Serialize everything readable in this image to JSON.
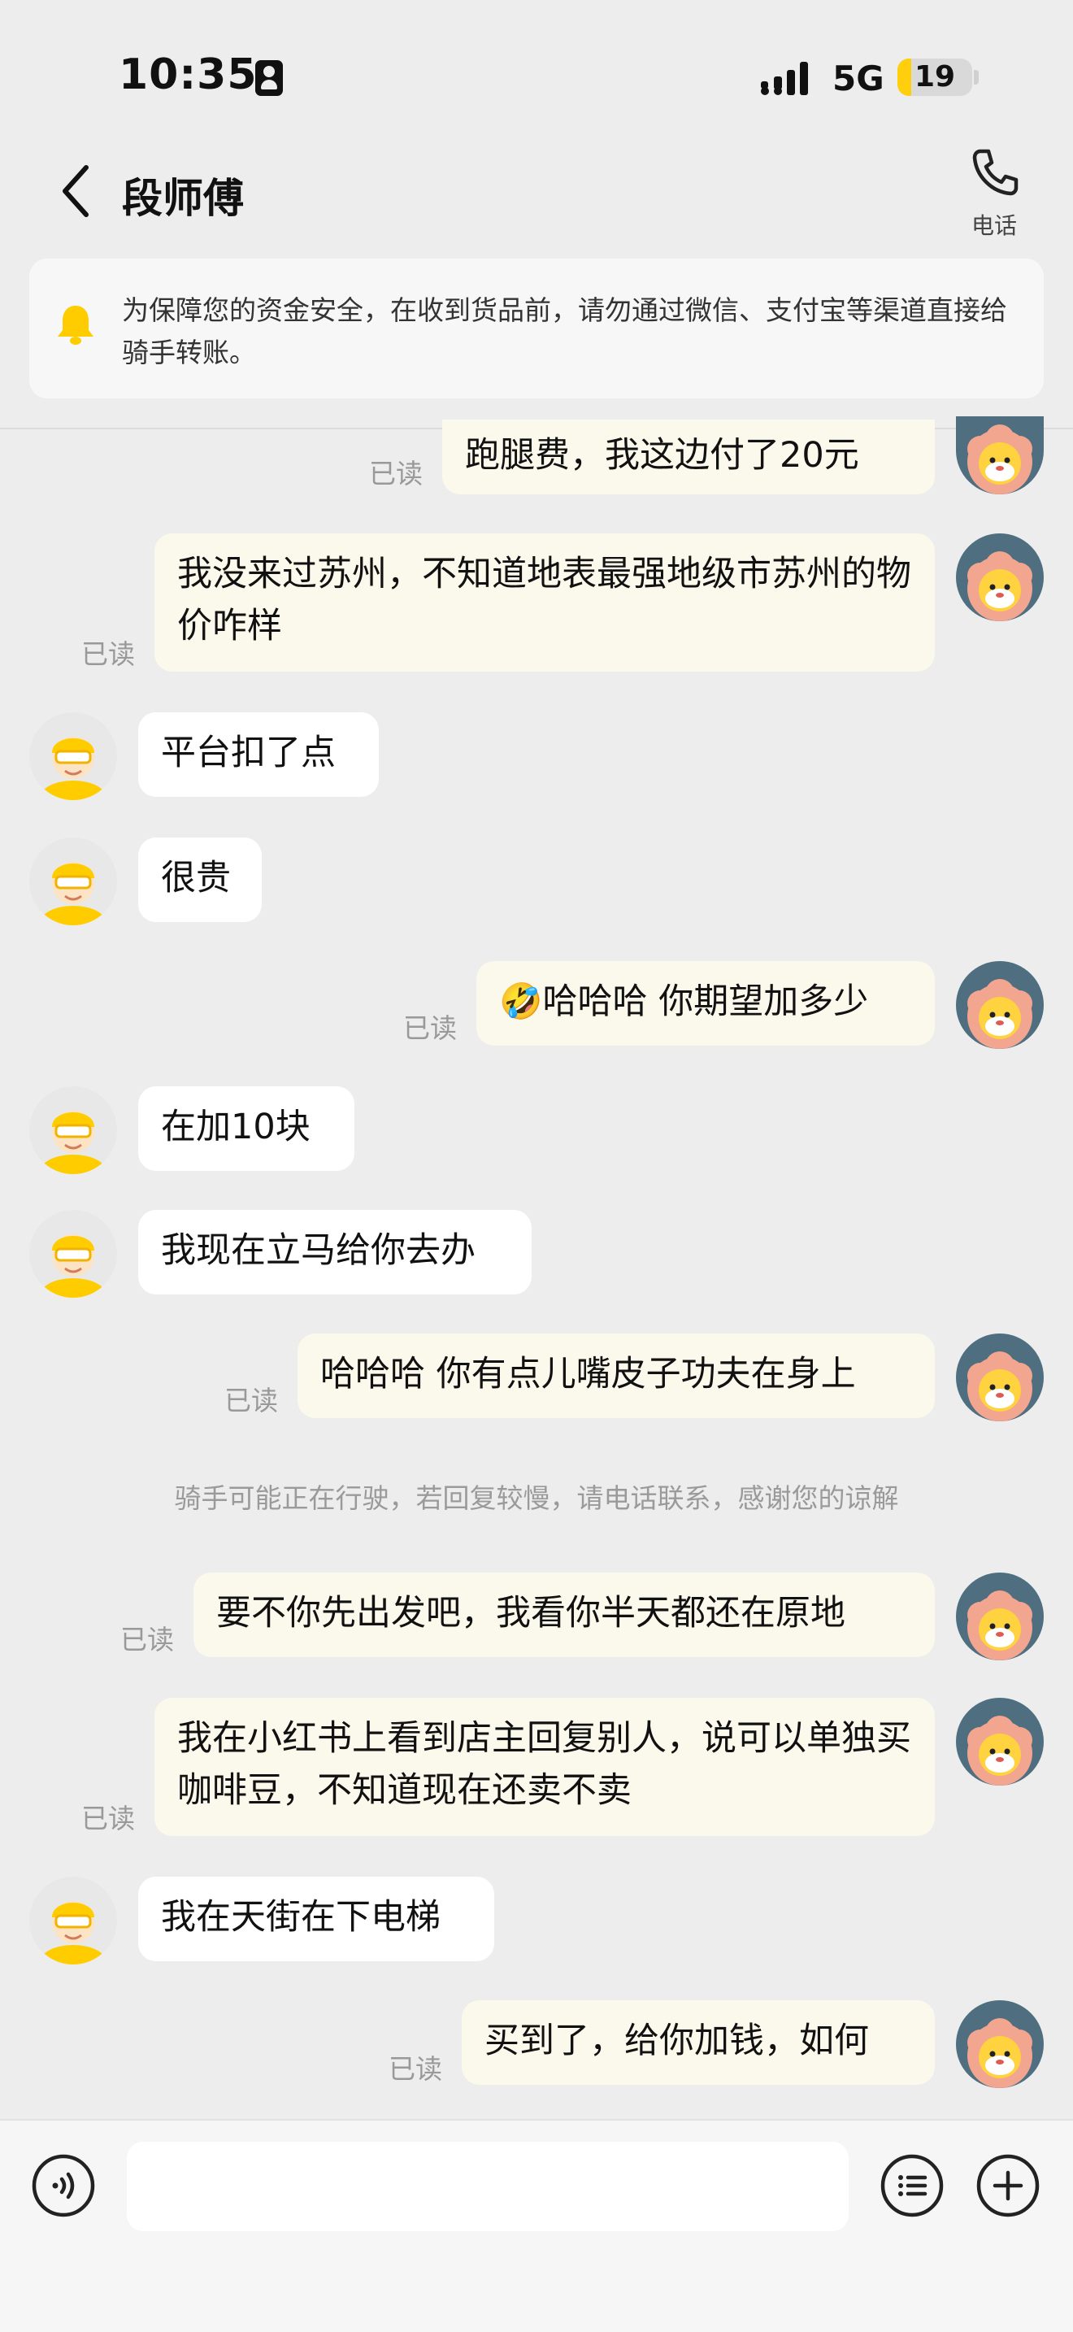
{
  "status_bar": {
    "time": "10:35",
    "network": "5G",
    "battery": "19",
    "battery_level": 0.19
  },
  "header": {
    "title": "段师傅",
    "phone_label": "电话"
  },
  "notice": {
    "text": "为保障您的资金安全，在收到货品前，请勿通过微信、支付宝等渠道直接给骑手转账。"
  },
  "read_label": "已读",
  "messages": [
    {
      "from": "me",
      "text": "跑腿费，我这边付了20元",
      "read": true
    },
    {
      "from": "me",
      "text": "我没来过苏州，不知道地表最强地级市苏州的物价咋样",
      "read": true
    },
    {
      "from": "rider",
      "text": "平台扣了点"
    },
    {
      "from": "rider",
      "text": "很贵"
    },
    {
      "from": "me",
      "text": "🤣哈哈哈 你期望加多少",
      "read": true
    },
    {
      "from": "rider",
      "text": "在加10块"
    },
    {
      "from": "rider",
      "text": "我现在立马给你去办"
    },
    {
      "from": "me",
      "text": "哈哈哈 你有点儿嘴皮子功夫在身上",
      "read": true
    },
    {
      "from": "me",
      "text": "要不你先出发吧，我看你半天都还在原地",
      "read": true
    },
    {
      "from": "me",
      "text": "我在小红书上看到店主回复别人，说可以单独买咖啡豆，不知道现在还卖不卖",
      "read": true
    },
    {
      "from": "rider",
      "text": "我在天街在下电梯"
    },
    {
      "from": "me",
      "text": "买到了，给你加钱，如何",
      "read": true
    }
  ],
  "system_note": "骑手可能正在行驶，若回复较慢，请电话联系，感谢您的谅解",
  "input": {
    "placeholder": ""
  },
  "colors": {
    "background": "#ededed",
    "my_bubble": "#fbf9ec",
    "rider_bubble": "#ffffff",
    "accent_yellow": "#ffcf0d",
    "my_avatar_bg": "#4f6e80"
  },
  "icons": {
    "back": "chevron-left-icon",
    "phone": "phone-icon",
    "notice": "bell-icon",
    "voice": "voice-icon",
    "quick_reply": "list-icon",
    "more": "plus-icon"
  }
}
